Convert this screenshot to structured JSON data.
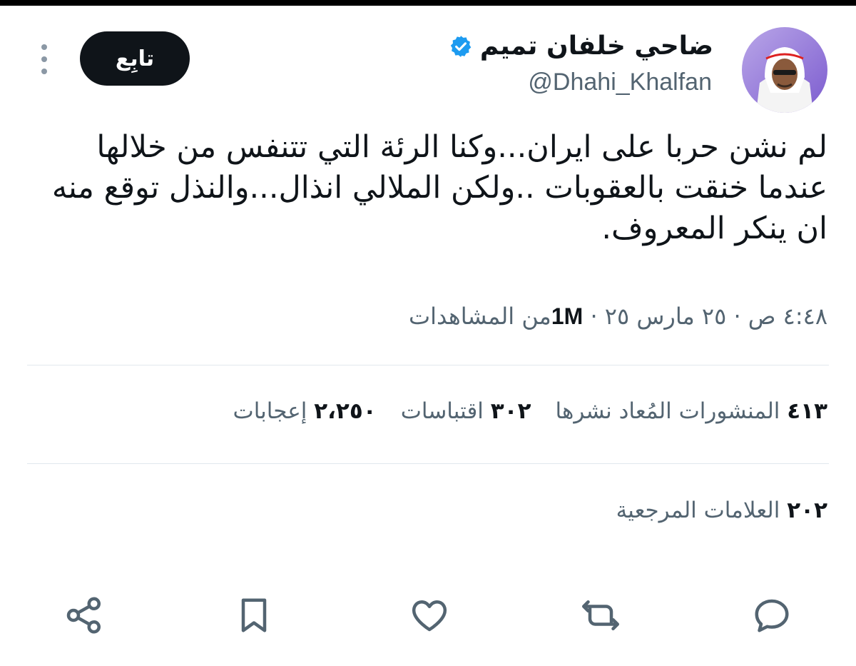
{
  "tweet": {
    "author_name": "ضاحي خلفان تميم",
    "handle": "@Dhahi_Khalfan",
    "follow_label": "تابِع",
    "text": "لم نشن حربا على ايران...وكنا الرئة التي تتنفس من خلالها عندما خنقت بالعقوبات ..ولكن الملالي انذال...والنذل توقع منه ان ينكر المعروف.",
    "time": "٤:٤٨ ص",
    "date": "٢٥ مارس ٢٥",
    "separator": "·",
    "views_count": "1M",
    "views_label": "من المشاهدات"
  },
  "stats": {
    "reposts_count": "٤١٣",
    "reposts_label": "المنشورات المُعاد نشرها",
    "quotes_count": "٣٠٢",
    "quotes_label": "اقتباسات",
    "likes_count": "٢،٢٥٠",
    "likes_label": "إعجابات",
    "bookmarks_count": "٢٠٢",
    "bookmarks_label": "العلامات المرجعية"
  },
  "icons": {
    "verified": "verified-badge-icon",
    "more": "more-vertical-icon",
    "reply": "reply-icon",
    "repost": "repost-icon",
    "like": "heart-icon",
    "bookmark": "bookmark-icon",
    "share": "share-icon"
  },
  "colors": {
    "text": "#0f1419",
    "secondary": "#536471",
    "verified_blue": "#1d9bf0",
    "button_bg": "#0f1419"
  }
}
